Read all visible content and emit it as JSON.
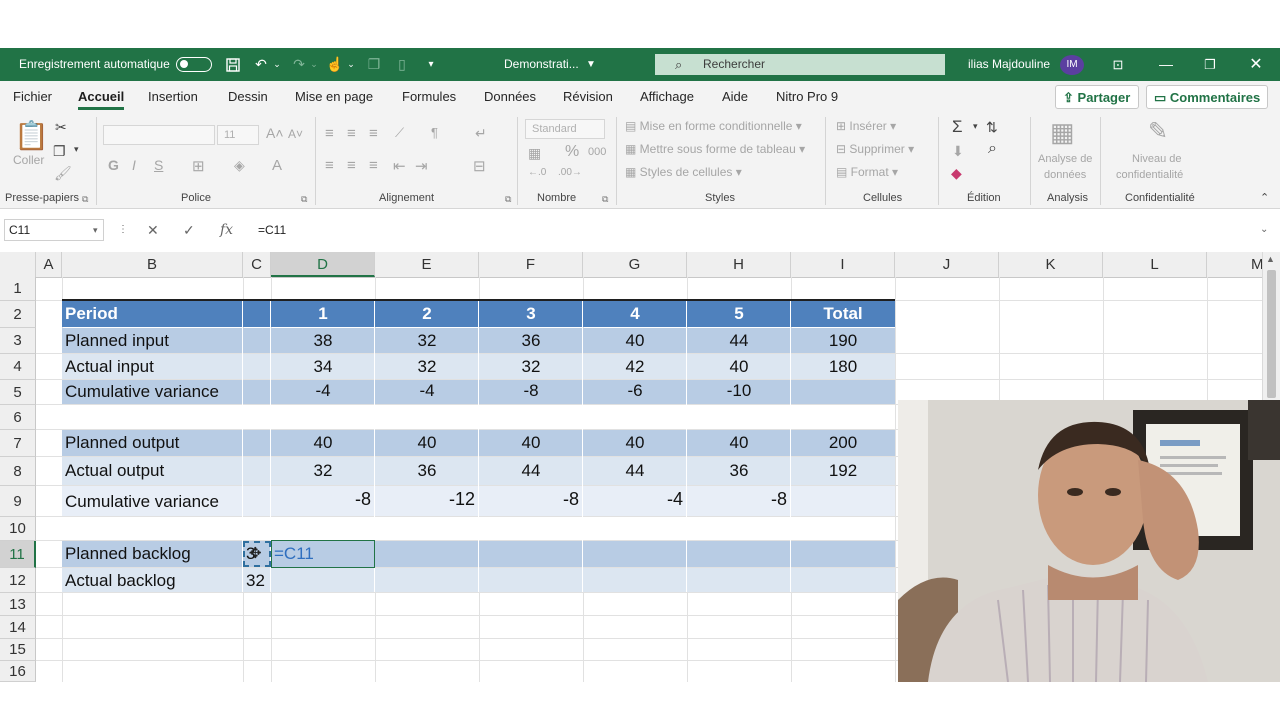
{
  "colors": {
    "excel_green": "#217346",
    "header_blue": "#4f81bd",
    "band_dark": "#b8cce4",
    "band_light": "#dce6f1"
  },
  "titlebar": {
    "autosave_label": "Enregistrement automatique",
    "doc_name": "Demonstrati...",
    "search_placeholder": "Rechercher",
    "user_name": "ilias Majdouline",
    "user_initials": "IM"
  },
  "menu": {
    "tabs": [
      "Fichier",
      "Accueil",
      "Insertion",
      "Dessin",
      "Mise en page",
      "Formules",
      "Données",
      "Révision",
      "Affichage",
      "Aide",
      "Nitro Pro 9"
    ],
    "share": "Partager",
    "comments": "Commentaires"
  },
  "ribbon": {
    "clipboard": {
      "paste": "Coller",
      "label": "Presse-papiers"
    },
    "font": {
      "size": "11",
      "bold": "G",
      "italic": "I",
      "underline": "S",
      "label": "Police"
    },
    "alignment": {
      "label": "Alignement"
    },
    "number": {
      "format": "Standard",
      "label": "Nombre",
      "pct": "%",
      "thousands": "000"
    },
    "styles": {
      "conditional": "Mise en forme conditionnelle",
      "table": "Mettre sous forme de tableau",
      "cell_styles": "Styles de cellules",
      "label": "Styles"
    },
    "cells": {
      "insert": "Insérer",
      "delete": "Supprimer",
      "format": "Format",
      "label": "Cellules"
    },
    "editing": {
      "label": "Édition"
    },
    "analysis": {
      "button_line1": "Analyse de",
      "button_line2": "données",
      "label": "Analysis"
    },
    "sensitivity": {
      "button_line1": "Niveau de",
      "button_line2": "confidentialité",
      "label": "Confidentialité"
    }
  },
  "formula_bar": {
    "name_box": "C11",
    "formula": "=C11",
    "fx": "fx"
  },
  "columns": [
    "A",
    "B",
    "C",
    "D",
    "E",
    "F",
    "G",
    "H",
    "I",
    "J",
    "K",
    "L",
    "M"
  ],
  "rows": [
    "1",
    "2",
    "3",
    "4",
    "5",
    "6",
    "7",
    "8",
    "9",
    "10",
    "11",
    "12",
    "13",
    "14",
    "15",
    "16"
  ],
  "sheet": {
    "header": {
      "label": "Period",
      "periods": [
        "1",
        "2",
        "3",
        "4",
        "5"
      ],
      "total": "Total"
    },
    "planned_input": {
      "label": "Planned input",
      "values": [
        "38",
        "32",
        "36",
        "40",
        "44"
      ],
      "total": "190"
    },
    "actual_input": {
      "label": "Actual input",
      "values": [
        "34",
        "32",
        "32",
        "42",
        "40"
      ],
      "total": "180"
    },
    "cum_var_input": {
      "label": "Cumulative variance",
      "values": [
        "-4",
        "-4",
        "-8",
        "-6",
        "-10"
      ]
    },
    "planned_output": {
      "label": "Planned output",
      "values": [
        "40",
        "40",
        "40",
        "40",
        "40"
      ],
      "total": "200"
    },
    "actual_output": {
      "label": "Actual output",
      "values": [
        "32",
        "36",
        "44",
        "44",
        "36"
      ],
      "total": "192"
    },
    "cum_var_output": {
      "label": "Cumulative variance",
      "values": [
        "-8",
        "-12",
        "-8",
        "-4",
        "-8"
      ]
    },
    "planned_backlog": {
      "label": "Planned backlog",
      "c_value": "3",
      "editing": "=C11"
    },
    "actual_backlog": {
      "label": "Actual backlog",
      "c_value": "32"
    }
  }
}
